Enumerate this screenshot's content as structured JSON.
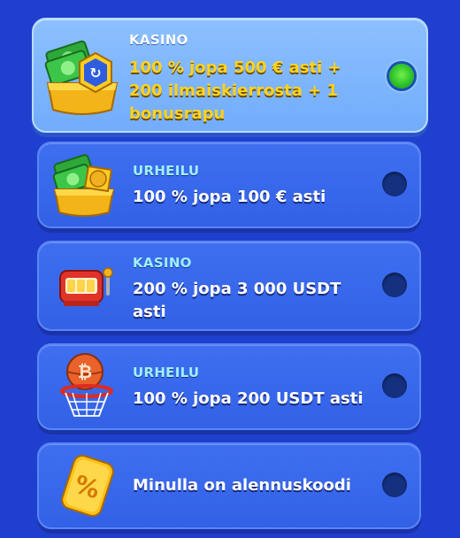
{
  "offers": [
    {
      "tag": "KASINO",
      "title_lines": [
        "100 % jopa 500 € asti +",
        "200 ilmaiskierrosta + 1",
        "bonusrapu"
      ],
      "selected": true,
      "icon": "cash-chest-chip-icon"
    },
    {
      "tag": "URHEILU",
      "title_lines": [
        "100 % jopa 100 € asti"
      ],
      "selected": false,
      "icon": "cash-chest-ball-icon"
    },
    {
      "tag": "KASINO",
      "title_lines": [
        "200 % jopa 3 000 USDT",
        "asti"
      ],
      "selected": false,
      "icon": "slot-machine-icon"
    },
    {
      "tag": "URHEILU",
      "title_lines": [
        "100 % jopa 200 USDT asti"
      ],
      "selected": false,
      "icon": "bitcoin-basketball-icon"
    },
    {
      "tag": "",
      "title_lines": [
        "Minulla on alennuskoodi"
      ],
      "selected": false,
      "icon": "percent-ticket-icon"
    }
  ],
  "colors": {
    "background": "#1f3fcf",
    "selected_title": "#ffd21f",
    "tag": "#9ff0ff",
    "radio_on": "#2ec22a"
  }
}
